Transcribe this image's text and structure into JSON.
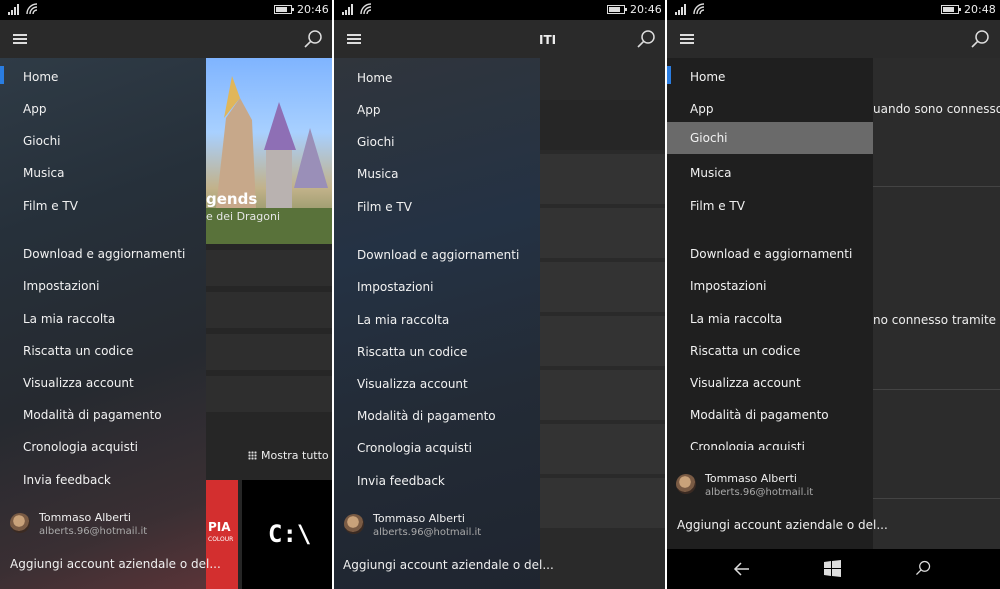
{
  "screens": [
    {
      "status_time": "20:46",
      "header_title": "",
      "menu": [
        "Home",
        "App",
        "Giochi",
        "Musica",
        "Film e TV",
        "Download e aggiornamenti",
        "Impostazioni",
        "La mia raccolta",
        "Riscatta un codice",
        "Visualizza account",
        "Modalità di pagamento",
        "Cronologia acquisti",
        "Invia feedback"
      ],
      "account": {
        "name": "Tommaso Alberti",
        "email": "alberts.96@hotmail.it",
        "add_account": "Aggiungi account aziendale o del..."
      },
      "behind": {
        "hero_title": "gends",
        "hero_subtitle": "e dei Dragoni",
        "show_all": "Mostra tutto",
        "tile_text_1": "PIA",
        "tile_text_2": "COLOUR",
        "tile_cmd": "C:\\"
      }
    },
    {
      "status_time": "20:46",
      "header_title": "ITI",
      "menu": [
        "Home",
        "App",
        "Giochi",
        "Musica",
        "Film e TV",
        "Download e aggiornamenti",
        "Impostazioni",
        "La mia raccolta",
        "Riscatta un codice",
        "Visualizza account",
        "Modalità di pagamento",
        "Cronologia acquisti",
        "Invia feedback"
      ],
      "account": {
        "name": "Tommaso Alberti",
        "email": "alberts.96@hotmail.it",
        "add_account": "Aggiungi account aziendale o del..."
      }
    },
    {
      "status_time": "20:48",
      "header_title": "",
      "menu": [
        "Home",
        "App",
        "Giochi",
        "Musica",
        "Film e TV",
        "Download e aggiornamenti",
        "Impostazioni",
        "La mia raccolta",
        "Riscatta un codice",
        "Visualizza account",
        "Modalità di pagamento",
        "Cronologia acquisti"
      ],
      "selected_item": "Giochi",
      "account": {
        "name": "Tommaso Alberti",
        "email": "alberts.96@hotmail.it",
        "add_account": "Aggiungi account aziendale o del..."
      },
      "behind": {
        "line_1": "uando sono connesso",
        "line_2": "no connesso tramite"
      }
    }
  ],
  "icons": {
    "menu": "hamburger-icon",
    "search": "search-icon",
    "back": "back-arrow-icon",
    "start": "windows-start-icon",
    "nav_search": "search-icon",
    "grid": "grid-icon"
  },
  "colors": {
    "accent": "#2a7de1",
    "panel_bg": "#1e1e1e",
    "selected_bg": "#6a6a6a"
  }
}
